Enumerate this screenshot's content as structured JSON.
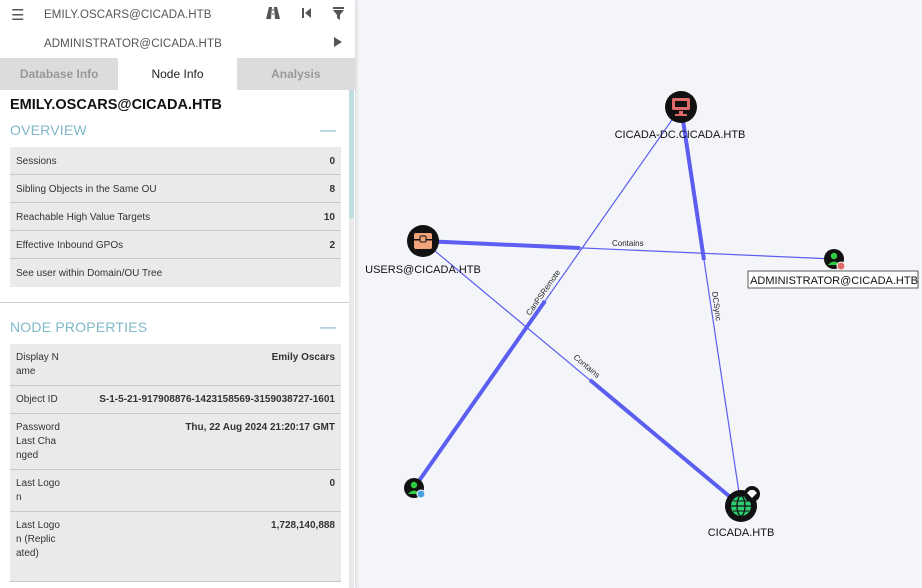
{
  "panel": {
    "search_source": "EMILY.OSCARS@CICADA.HTB",
    "search_target": "ADMINISTRATOR@CICADA.HTB",
    "icons": {
      "menu": "hamburger-icon",
      "pathfinding": "road-icon",
      "back": "skip-back-icon",
      "filter": "filter-icon",
      "play": "play-icon"
    },
    "tabs": [
      {
        "label": "Database Info",
        "active": false
      },
      {
        "label": "Node Info",
        "active": true
      },
      {
        "label": "Analysis",
        "active": false
      }
    ],
    "node_name": "EMILY.OSCARS@CICADA.HTB",
    "overview": {
      "title": "OVERVIEW",
      "collapse": "—",
      "rows": [
        {
          "label": "Sessions",
          "value": "0"
        },
        {
          "label": "Sibling Objects in the Same OU",
          "value": "8"
        },
        {
          "label": "Reachable High Value Targets",
          "value": "10"
        },
        {
          "label": "Effective Inbound GPOs",
          "value": "2"
        },
        {
          "label": "See user within Domain/OU Tree",
          "value": ""
        }
      ]
    },
    "properties": {
      "title": "NODE PROPERTIES",
      "collapse": "—",
      "rows": [
        {
          "label": "Display Name",
          "value": "Emily Oscars"
        },
        {
          "label": "Object ID",
          "value": "S-1-5-21-917908876-1423158569-3159038727-1601"
        },
        {
          "label": "Password Last Changed",
          "value": "Thu, 22 Aug 2024 21:20:17 GMT"
        },
        {
          "label": "Last Logon",
          "value": "0"
        },
        {
          "label": "Last Logon (Replicated)",
          "value": "1,728,140,888"
        }
      ]
    }
  },
  "graph": {
    "edge_color": "#5b5ef0",
    "nodes": {
      "dc": {
        "label": "CICADA-DC.CICADA.HTB",
        "icon": "computer-icon",
        "color": "#e06a6a"
      },
      "users": {
        "label": "USERS@CICADA.HTB",
        "icon": "group-icon",
        "color": "#f2a37a"
      },
      "admin": {
        "label": "ADMINISTRATOR@CICADA.HTB",
        "icon": "user-icon",
        "color": "#2ecc40"
      },
      "emily": {
        "label": "",
        "icon": "user-icon",
        "color": "#2ecc40"
      },
      "domain": {
        "label": "CICADA.HTB",
        "icon": "globe-icon",
        "color": "#2ecc71"
      }
    },
    "edges": [
      {
        "label": "Contains"
      },
      {
        "label": "CanPSRemote"
      },
      {
        "label": "DCSync"
      },
      {
        "label": "Contains"
      }
    ]
  }
}
